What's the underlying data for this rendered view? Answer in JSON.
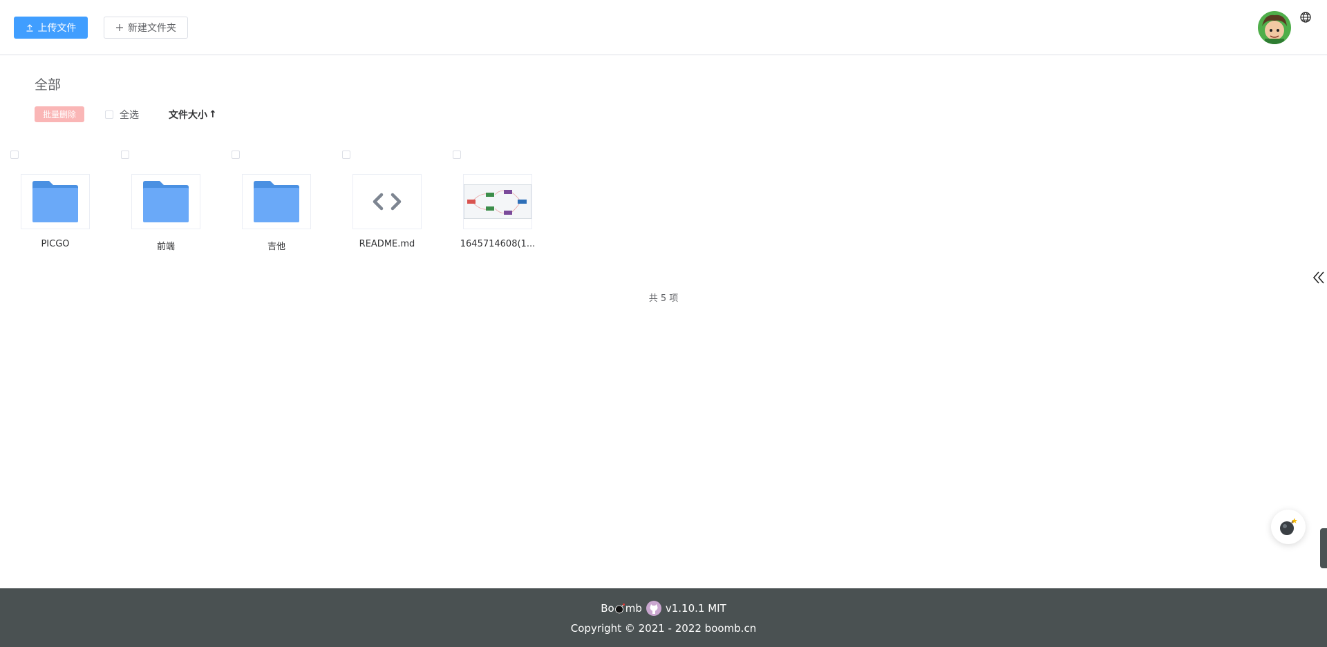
{
  "header": {
    "upload_label": "上传文件",
    "new_folder_label": "新建文件夹"
  },
  "toolbar": {
    "breadcrumb": "全部",
    "batch_delete_label": "批量删除",
    "select_all_label": "全选",
    "sort_label": "文件大小",
    "sort_arrow": "↑"
  },
  "files": [
    {
      "name": "PICGO",
      "type": "folder"
    },
    {
      "name": "前端",
      "type": "folder"
    },
    {
      "name": "吉他",
      "type": "folder"
    },
    {
      "name": "README.md",
      "type": "code"
    },
    {
      "name": "1645714608(1...",
      "type": "image"
    }
  ],
  "total": "共 5 项",
  "footer": {
    "brand_left": "Bo",
    "brand_right": "mb",
    "version": "v1.10.1 MIT",
    "copyright": "Copyright © 2021 - 2022 boomb.cn"
  },
  "colors": {
    "primary": "#409eff",
    "danger_light": "#fab6b6",
    "folder": "#5ea2f9",
    "footer_bg": "#4a5152"
  }
}
